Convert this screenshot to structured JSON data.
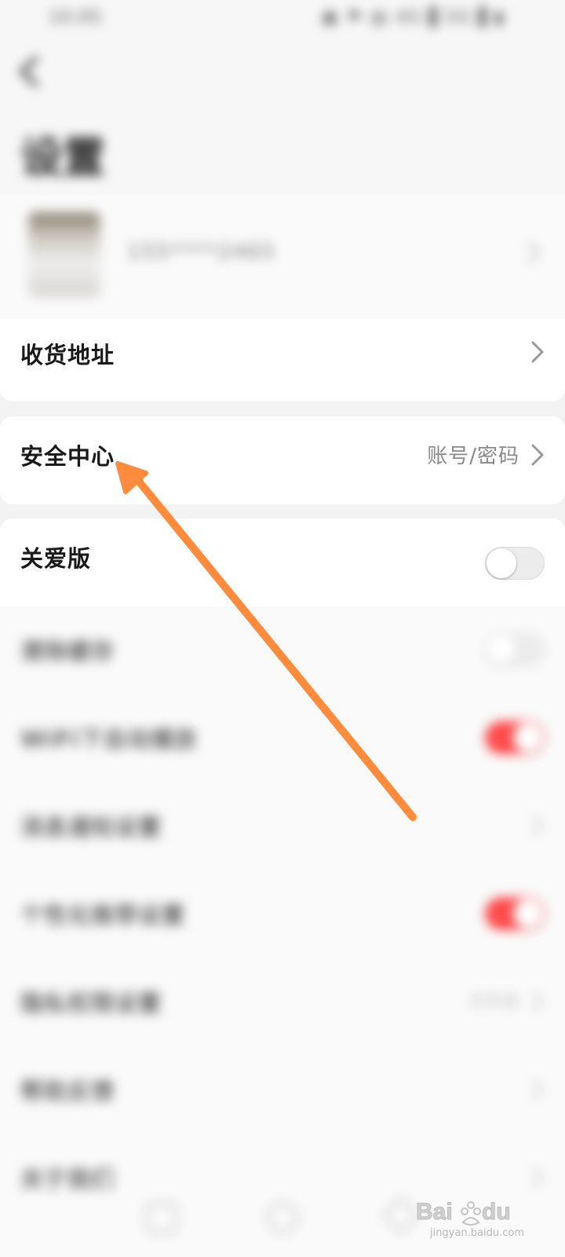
{
  "status_bar": {
    "time": "10:05",
    "icons": "▣ ⚑ ▤ 4G▐ 5G▐ ▮"
  },
  "header": {
    "title": "设置",
    "back_icon": "chevron-left-icon"
  },
  "profile": {
    "phone": "155****2465"
  },
  "rows": {
    "address": {
      "label": "收货地址"
    },
    "security": {
      "label": "安全中心",
      "value": "账号/密码"
    },
    "elder_mode": {
      "label": "关爱版",
      "enabled": false
    }
  },
  "blurred_list": [
    {
      "label": "清除缓存",
      "control": "toggle",
      "enabled": false
    },
    {
      "label": "WiFi下自动播放",
      "control": "toggle",
      "enabled": true
    },
    {
      "label": "消息通知设置",
      "control": "chevron"
    },
    {
      "label": "个性化推荐设置",
      "control": "toggle",
      "enabled": true
    },
    {
      "label": "隐私权限设置",
      "control": "chevron",
      "value": "已开启"
    },
    {
      "label": "帮助反馈",
      "control": "chevron"
    },
    {
      "label": "关于我们",
      "control": "chevron"
    }
  ],
  "watermark": {
    "text": "jingyan.baidu.com"
  },
  "colors": {
    "accent": "#ff4a4a",
    "annotation": "#ff8c3c",
    "background": "#f3f3f3"
  }
}
